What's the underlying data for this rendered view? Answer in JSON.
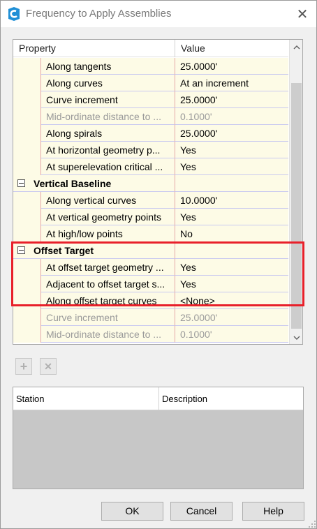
{
  "window": {
    "title": "Frequency to Apply Assemblies",
    "close_glyph": "✕"
  },
  "grid": {
    "columns": {
      "property": "Property",
      "value": "Value"
    },
    "rows": [
      {
        "kind": "item",
        "property": "Along tangents",
        "value": "25.0000'",
        "disabled": false
      },
      {
        "kind": "item",
        "property": "Along curves",
        "value": "At an increment",
        "disabled": false
      },
      {
        "kind": "item",
        "property": "Curve increment",
        "value": "25.0000'",
        "disabled": false
      },
      {
        "kind": "item",
        "property": "Mid-ordinate distance to ...",
        "value": "0.1000'",
        "disabled": true
      },
      {
        "kind": "item",
        "property": "Along spirals",
        "value": "25.0000'",
        "disabled": false
      },
      {
        "kind": "item",
        "property": "At horizontal geometry p...",
        "value": "Yes",
        "disabled": false
      },
      {
        "kind": "item",
        "property": "At superelevation critical ...",
        "value": "Yes",
        "disabled": false
      },
      {
        "kind": "group",
        "property": "Vertical Baseline",
        "value": ""
      },
      {
        "kind": "item",
        "property": "Along vertical curves",
        "value": "10.0000'",
        "disabled": false
      },
      {
        "kind": "item",
        "property": "At vertical geometry points",
        "value": "Yes",
        "disabled": false
      },
      {
        "kind": "item",
        "property": "At high/low points",
        "value": "No",
        "disabled": false
      },
      {
        "kind": "group",
        "property": "Offset Target",
        "value": ""
      },
      {
        "kind": "item",
        "property": "At offset target geometry ...",
        "value": "Yes",
        "disabled": false
      },
      {
        "kind": "item",
        "property": "Adjacent to offset target s...",
        "value": "Yes",
        "disabled": false
      },
      {
        "kind": "item",
        "property": "Along offset target curves",
        "value": "<None>",
        "disabled": false
      },
      {
        "kind": "item",
        "property": "Curve increment",
        "value": "25.0000'",
        "disabled": true
      },
      {
        "kind": "item",
        "property": "Mid-ordinate distance to ...",
        "value": "0.1000'",
        "disabled": true
      }
    ]
  },
  "toolbar": {
    "add_glyph": "+",
    "delete_glyph": "✕"
  },
  "station_list": {
    "columns": {
      "station": "Station",
      "description": "Description"
    }
  },
  "buttons": {
    "ok": "OK",
    "cancel": "Cancel",
    "help": "Help"
  },
  "colors": {
    "highlight": "#e8202a",
    "row_background": "#fdfbe6",
    "accent_icon": "#1f8fd6"
  }
}
